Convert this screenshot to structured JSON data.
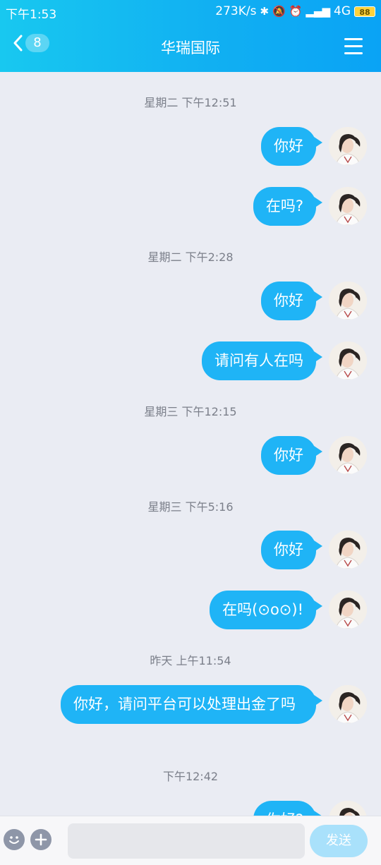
{
  "status": {
    "time": "下午1:53",
    "network_speed": "273K/s",
    "signal": "4G",
    "battery": "88"
  },
  "nav": {
    "back_count": "8",
    "title": "华瑞国际"
  },
  "messages": {
    "ts1": "星期二 下午12:51",
    "m1": "你好",
    "m2": "在吗?",
    "ts2": "星期二 下午2:28",
    "m3": "你好",
    "m4": "请问有人在吗",
    "ts3": "星期三 下午12:15",
    "m5": "你好",
    "ts4": "星期三 下午5:16",
    "m6": "你好",
    "m7": "在吗(⊙o⊙)!",
    "ts5": "昨天 上午11:54",
    "m8": "你好，请问平台可以处理出金了吗",
    "ts6": "下午12:42",
    "m9": "你好?"
  },
  "input": {
    "placeholder": "",
    "send_label": "发送"
  },
  "colors": {
    "accent": "#1fb4f6",
    "header_start": "#18c8f0",
    "header_end": "#0aa3f5",
    "background": "#eaecf3"
  }
}
